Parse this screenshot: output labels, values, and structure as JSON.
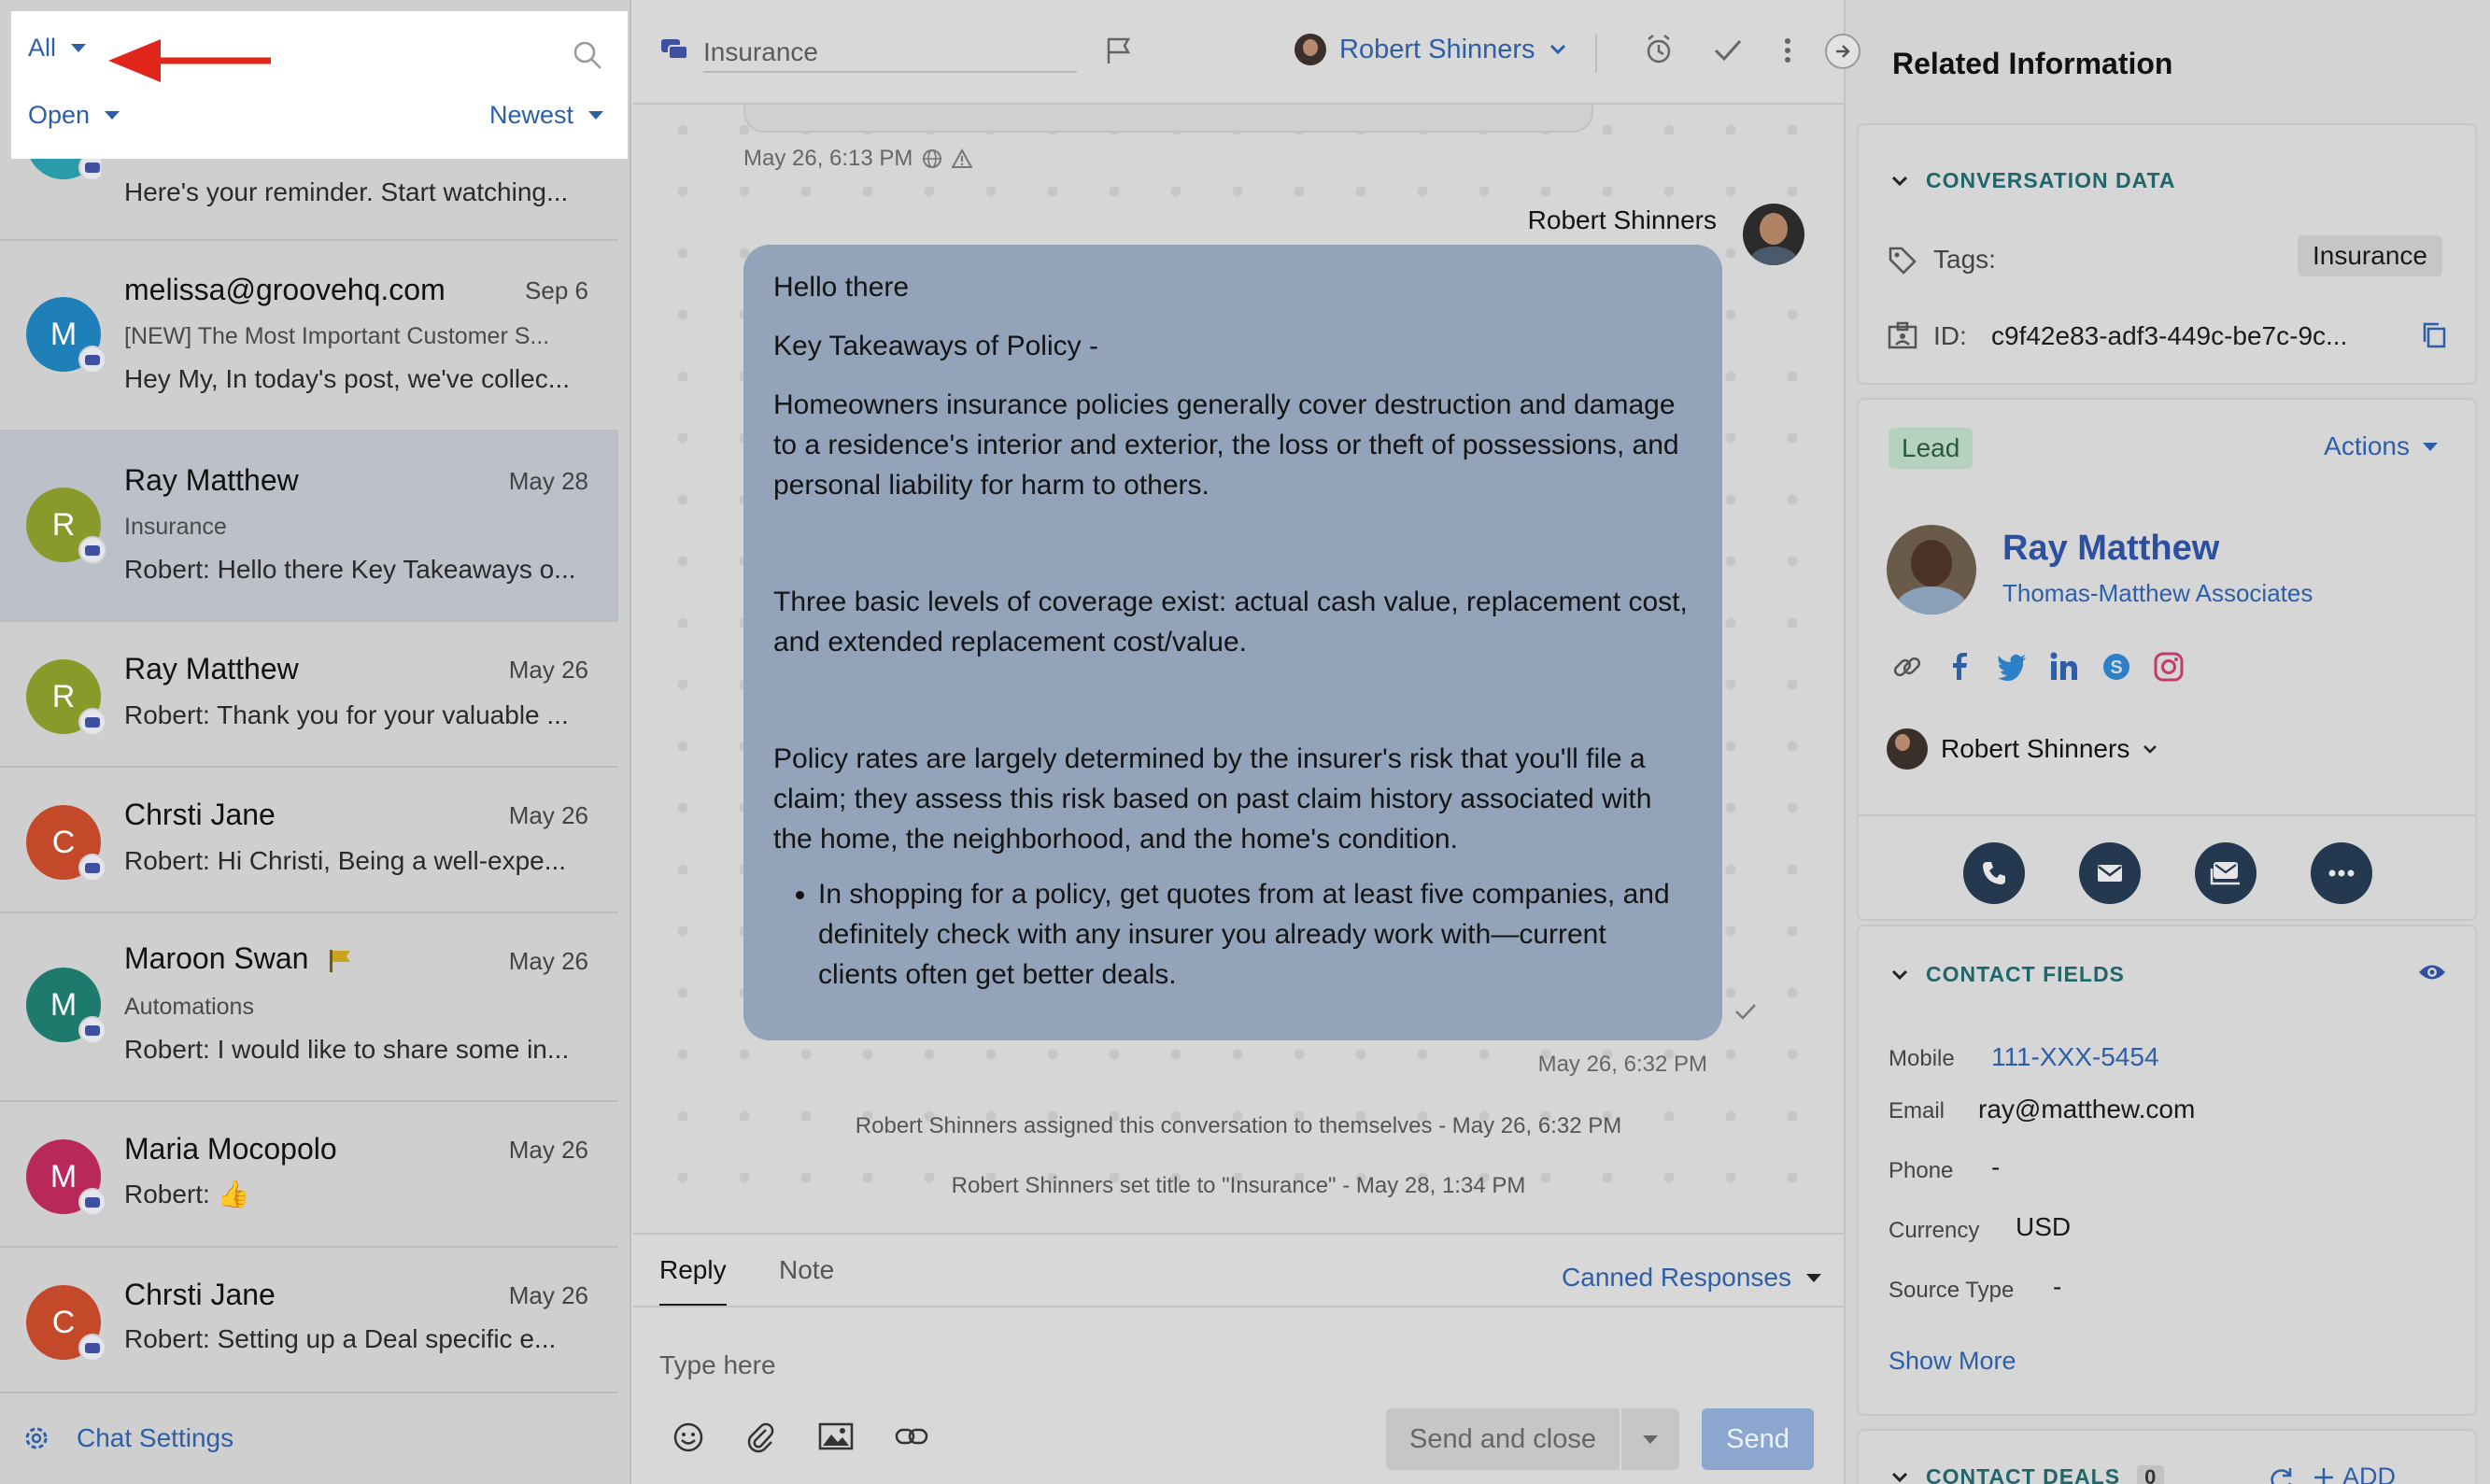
{
  "filters": {
    "scope": "All",
    "status": "Open",
    "sort": "Newest"
  },
  "conversations": [
    {
      "name": "",
      "date": "",
      "subject": "",
      "preview": "Here's your reminder. Start watching...",
      "initial": "",
      "color": "#2a9ba8"
    },
    {
      "name": "melissa@groovehq.com",
      "date": "Sep 6",
      "subject": "[NEW] The Most Important Customer S...",
      "preview": "Hey My, In today's post, we've collec...",
      "initial": "M",
      "color": "#1f7fb8"
    },
    {
      "name": "Ray Matthew",
      "date": "May 28",
      "subject": "Insurance",
      "preview": "Robert: Hello there Key Takeaways o...",
      "initial": "R",
      "color": "#8a9a2a"
    },
    {
      "name": "Ray Matthew",
      "date": "May 26",
      "subject": "",
      "preview": "Robert: Thank you for your valuable ...",
      "initial": "R",
      "color": "#8a9a2a"
    },
    {
      "name": "Chrsti Jane",
      "date": "May 26",
      "subject": "",
      "preview": "Robert: Hi Christi, Being a well-expe...",
      "initial": "C",
      "color": "#c4482a"
    },
    {
      "name": "Maroon Swan",
      "date": "May 26",
      "subject": "Automations",
      "preview": "Robert: I would like to share some in...",
      "initial": "M",
      "color": "#1f7a6e"
    },
    {
      "name": "Maria Mocopolo",
      "date": "May 26",
      "subject": "",
      "preview": "Robert: 👍",
      "initial": "M",
      "color": "#b8285a"
    },
    {
      "name": "Chrsti Jane",
      "date": "May 26",
      "subject": "",
      "preview": "Robert: Setting up a Deal specific e...",
      "initial": "C",
      "color": "#c4482a"
    }
  ],
  "chat_settings": "Chat Settings",
  "header": {
    "title_placeholder": "Insurance",
    "assignee": "Robert Shinners"
  },
  "messages": {
    "prev_meta": "May 26, 6:13 PM",
    "sender": "Robert Shinners",
    "greeting": "Hello there",
    "heading": "Key Takeaways of Policy -",
    "para1": "Homeowners insurance policies generally cover destruction and damage to a residence's interior and exterior, the loss or theft of possessions, and personal liability for harm to others.",
    "para2": "Three basic levels of coverage exist: actual cash value, replacement cost, and extended replacement cost/value.",
    "para3": "Policy rates are largely determined by the insurer's risk that you'll file a claim; they assess this risk based on past claim history associated with the home, the neighborhood, and the home's condition.",
    "bullet1": "In shopping for a policy, get quotes from at least five companies, and definitely check with any insurer you already work with—current clients often get better deals.",
    "meta": "May 26, 6:32 PM",
    "event1": "Robert Shinners assigned this conversation to themselves - May 26, 6:32 PM",
    "event2": "Robert Shinners set title to \"Insurance\" - May 28, 1:34 PM"
  },
  "composer": {
    "tab_reply": "Reply",
    "tab_note": "Note",
    "canned": "Canned Responses",
    "placeholder": "Type here",
    "send_close": "Send and close",
    "send": "Send"
  },
  "related": {
    "title": "Related Information",
    "conversation_data": {
      "heading": "CONVERSATION DATA",
      "tags_label": "Tags:",
      "tag": "Insurance",
      "id_label": "ID:",
      "id_value": "c9f42e83-adf3-449c-be7c-9c..."
    },
    "contact": {
      "badge": "Lead",
      "actions": "Actions",
      "name": "Ray Matthew",
      "company": "Thomas-Matthew Associates",
      "owner": "Robert Shinners"
    },
    "contact_fields": {
      "heading": "CONTACT FIELDS",
      "mobile_label": "Mobile",
      "mobile": "111-XXX-5454",
      "email_label": "Email",
      "email": "ray@matthew.com",
      "phone_label": "Phone",
      "phone": "-",
      "currency_label": "Currency",
      "currency": "USD",
      "source_label": "Source Type",
      "source": "-",
      "show_more": "Show More"
    },
    "contact_deals": {
      "heading": "CONTACT DEALS",
      "count": "0",
      "add": "ADD"
    }
  },
  "colors": {
    "accent": "#2d5fa8",
    "annotation_arrow": "#e0251b",
    "section_teal": "#20666a"
  }
}
